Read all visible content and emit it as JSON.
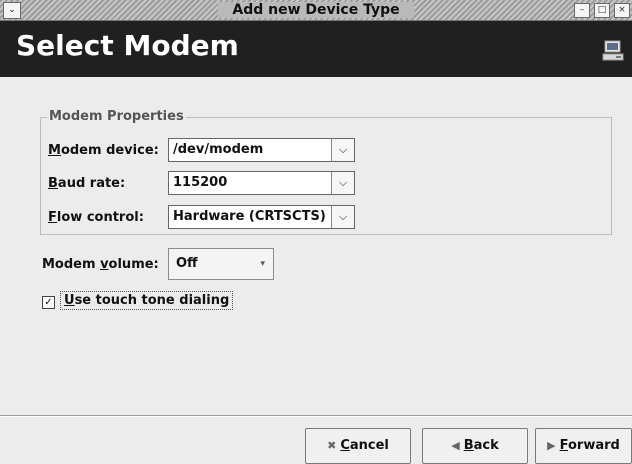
{
  "window": {
    "title": "Add new Device Type",
    "menu_glyph": "⌄",
    "min_glyph": "–",
    "max_glyph": "□",
    "close_glyph": "×"
  },
  "header": {
    "title": "Select Modem",
    "icon": "network-computer-icon"
  },
  "modem_properties": {
    "legend": "Modem Properties",
    "device": {
      "label_mnemonic": "M",
      "label_rest": "odem device:",
      "value": "/dev/modem"
    },
    "baud": {
      "label_mnemonic": "B",
      "label_rest": "aud rate:",
      "value": "115200"
    },
    "flow": {
      "label_mnemonic": "F",
      "label_rest": "low control:",
      "value": "Hardware (CRTSCTS)"
    }
  },
  "volume": {
    "label_prefix": "Modem ",
    "label_mnemonic": "v",
    "label_rest": "olume:",
    "value": "Off"
  },
  "touch_tone": {
    "checked": true,
    "check_glyph": "✓",
    "label_mnemonic": "U",
    "label_rest": "se touch tone dialing"
  },
  "buttons": {
    "cancel": {
      "icon": "✖",
      "mnemonic": "C",
      "rest": "ancel"
    },
    "back": {
      "icon": "◀",
      "mnemonic": "B",
      "rest": "ack"
    },
    "forward": {
      "icon": "▶",
      "mnemonic": "F",
      "rest": "orward"
    }
  },
  "colors": {
    "header_bg": "#202020",
    "window_bg": "#ececec"
  }
}
